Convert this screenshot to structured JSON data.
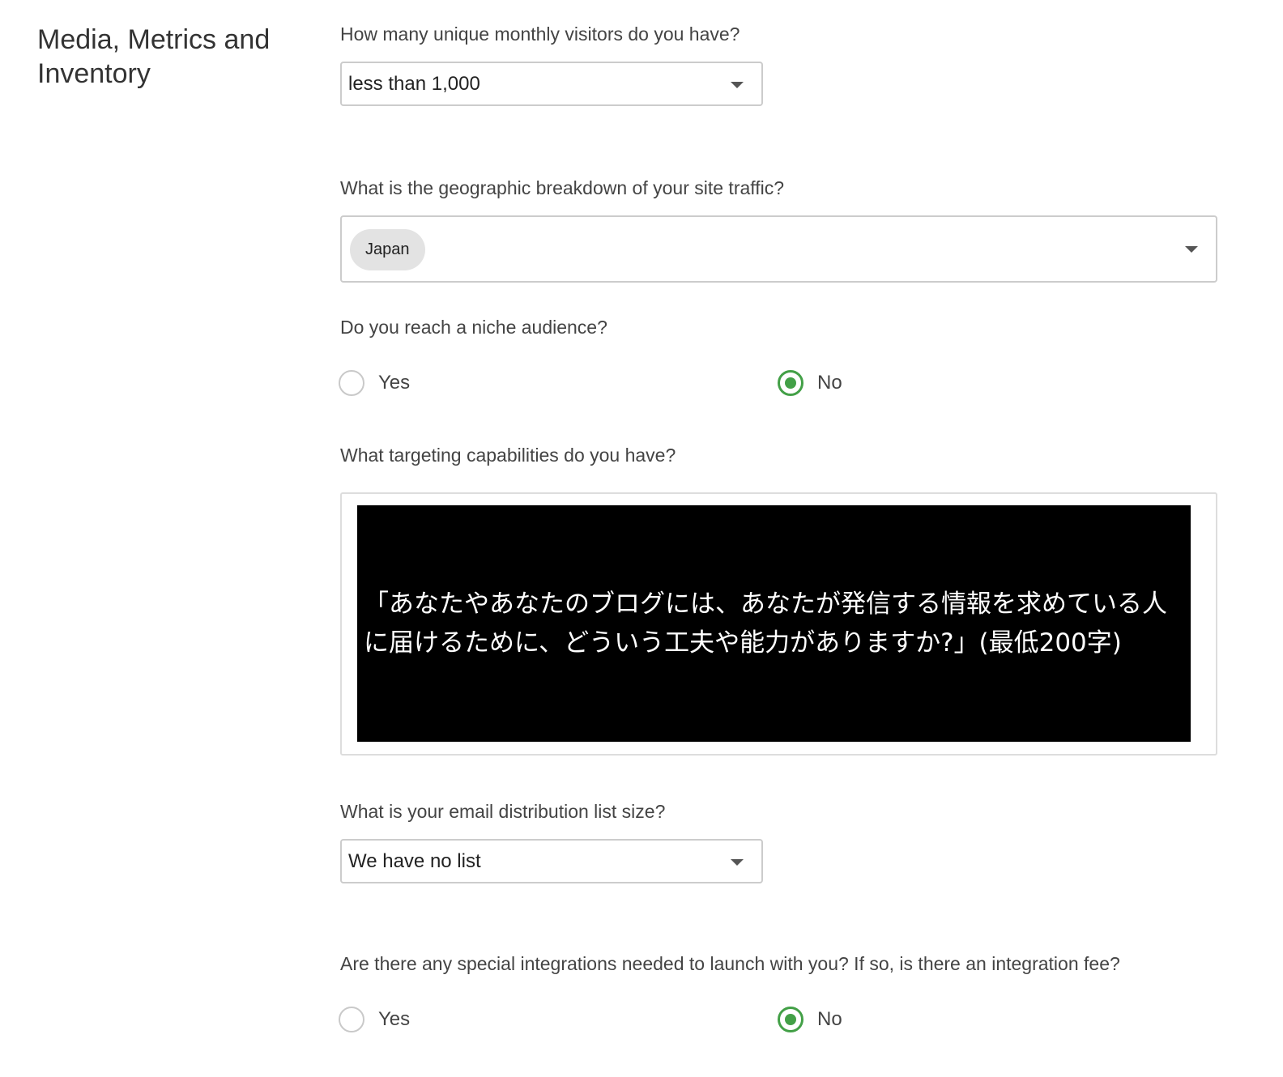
{
  "section": {
    "title": "Media, Metrics and Inventory"
  },
  "visitors": {
    "label": "How many unique monthly visitors do you have?",
    "value": "less than 1,000"
  },
  "geography": {
    "label": "What is the geographic breakdown of your site traffic?",
    "chips": [
      "Japan"
    ]
  },
  "niche": {
    "label": "Do you reach a niche audience?",
    "options": [
      {
        "label": "Yes",
        "checked": false
      },
      {
        "label": "No",
        "checked": true
      }
    ]
  },
  "targeting": {
    "label": "What targeting capabilities do you have?",
    "image_text": "「あなたやあなたのブログには、あなたが発信する情報を求めている人に届けるために、どういう工夫や能力がありますか?」(最低200字)"
  },
  "email_list": {
    "label": "What is your email distribution list size?",
    "value": "We have no list"
  },
  "integrations": {
    "label": "Are there any special integrations needed to launch with you? If so, is there an integration fee?",
    "options": [
      {
        "label": "Yes",
        "checked": false
      },
      {
        "label": "No",
        "checked": true
      }
    ]
  },
  "colors": {
    "accent_green": "#43a047",
    "border": "#cccccc",
    "chip_bg": "#e3e3e3"
  },
  "icons": {
    "dropdown": "caret-down-icon"
  }
}
